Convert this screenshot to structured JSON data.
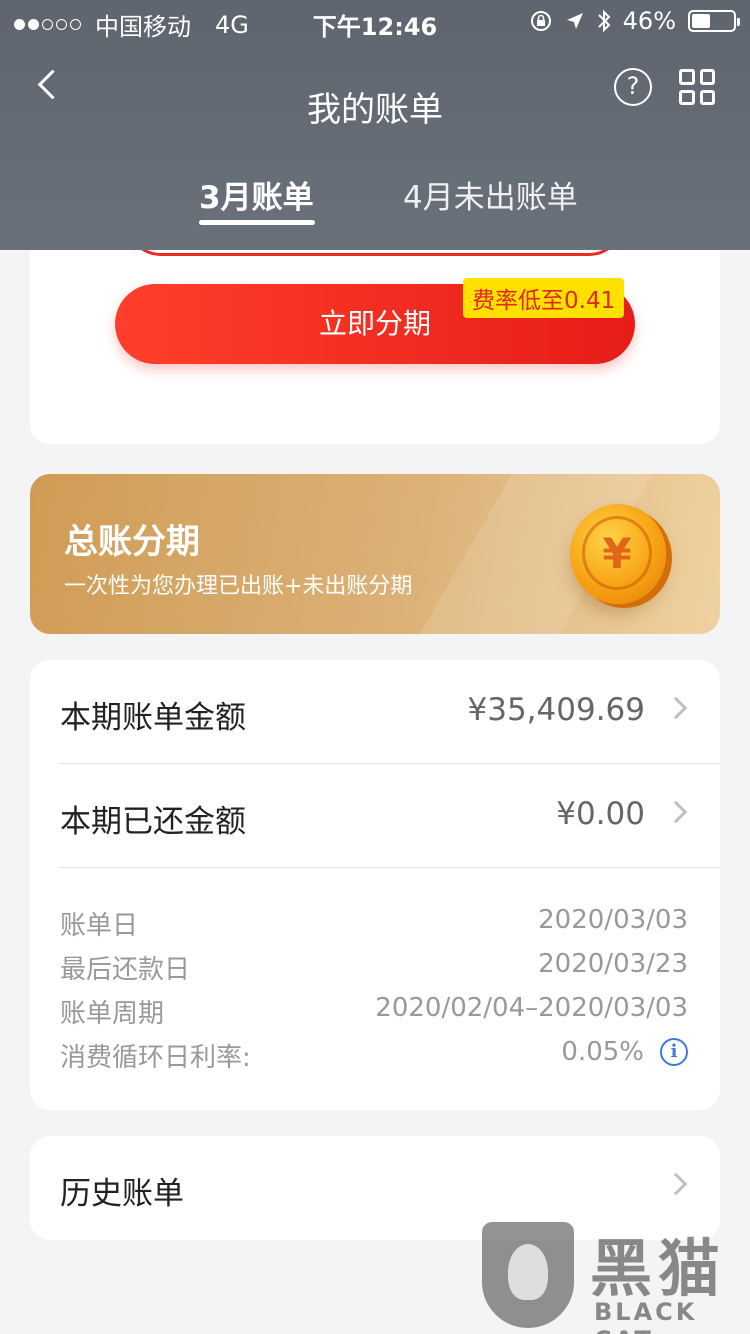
{
  "status_bar": {
    "carrier": "中国移动",
    "network": "4G",
    "time": "下午12:46",
    "battery": "46%",
    "battery_level": 0.46,
    "icons": [
      "lock-rotation-icon",
      "location-arrow-icon",
      "bluetooth-icon",
      "battery-icon"
    ]
  },
  "nav": {
    "title": "我的账单",
    "help_symbol": "?"
  },
  "tabs": [
    {
      "label": "3月账单",
      "active": true
    },
    {
      "label": "4月未出账单",
      "active": false
    }
  ],
  "installment": {
    "button_label": "立即分期",
    "badge": "费率低至0.41",
    "button_color": "#e61d18",
    "badge_color": "#ffe100"
  },
  "banner": {
    "title": "总账分期",
    "subtitle": "一次性为您办理已出账+未出账分期",
    "coin_symbol": "¥"
  },
  "bill": {
    "rows": [
      {
        "label": "本期账单金额",
        "value": "¥35,409.69"
      },
      {
        "label": "本期已还金额",
        "value": "¥0.00"
      }
    ],
    "details": [
      {
        "label": "账单日",
        "value": "2020/03/03"
      },
      {
        "label": "最后还款日",
        "value": "2020/03/23"
      },
      {
        "label": "账单周期",
        "value": "2020/02/04–2020/03/03"
      },
      {
        "label": "消费循环日利率:",
        "value": "0.05%"
      }
    ],
    "info_symbol": "i"
  },
  "history": {
    "label": "历史账单"
  },
  "watermark": {
    "cn": "黑猫",
    "en": "BLACK CAT"
  }
}
